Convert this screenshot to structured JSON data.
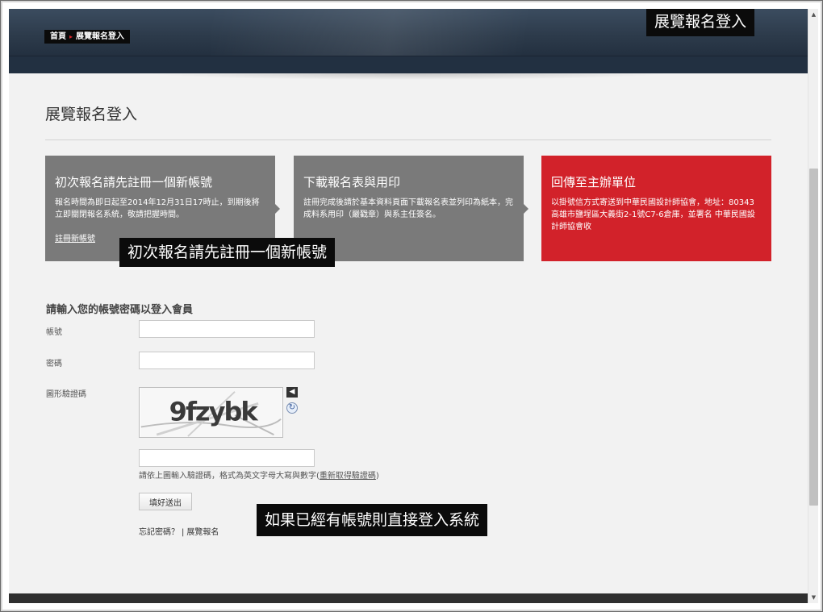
{
  "header": {
    "breadcrumb": {
      "home": "首頁",
      "separator": "▸",
      "current": "展覽報名登入"
    }
  },
  "overlays": {
    "top_label": "展覽報名登入",
    "register_label": "初次報名請先註冊一個新帳號",
    "login_label": "如果已經有帳號則直接登入系統"
  },
  "page": {
    "title": "展覽報名登入"
  },
  "steps": [
    {
      "title": "初次報名請先註冊一個新帳號",
      "text": "報名時間為即日起至2014年12月31日17時止，到期後將立即關閉報名系統，敬請把握時間。",
      "link": "註冊新帳號",
      "color": "#7a7a7a"
    },
    {
      "title": "下載報名表與用印",
      "text": "註冊完成後請於基本資料頁面下載報名表並列印為紙本，完成料系用印（嚴戳章）與系主任簽名。",
      "color": "#7a7a7a"
    },
    {
      "title": "回傳至主辦單位",
      "text": "以掛號信方式寄送到中華民國設計師協會，地址：80343高雄市鹽埕區大義街2-1號C7-6倉庫，並署名 中華民國設計師協會收",
      "color": "#d2222a"
    }
  ],
  "login": {
    "heading": "請輸入您的帳號密碼以登入會員",
    "account_label": "帳號",
    "account_value": "",
    "password_label": "密碼",
    "password_value": "",
    "captcha_label": "圖形驗證碼",
    "captcha_text": "9fzybk",
    "captcha_value": "",
    "captcha_hint": "請依上圖輸入驗證碼，格式為英文字母大寫與數字(",
    "captcha_refresh_link": "重新取得驗證碼",
    "captcha_hint_end": ")",
    "submit_label": "填好送出",
    "forgot_password": "忘記密碼？",
    "footer_separator": "|",
    "exhibition_signup": "展覽報名"
  },
  "icons": {
    "audio": "speaker-icon",
    "refresh": "refresh-icon",
    "scroll_up": "▲",
    "scroll_down": "▼"
  }
}
